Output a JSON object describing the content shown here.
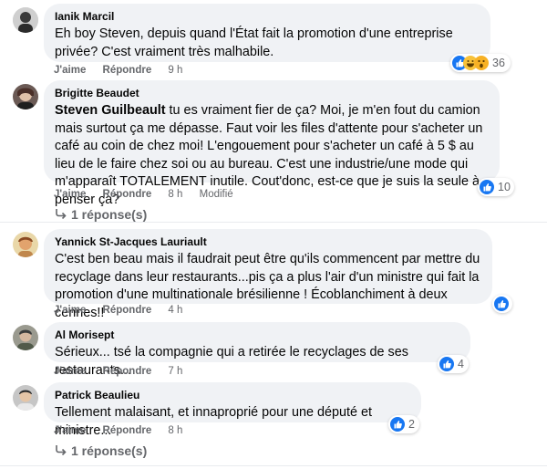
{
  "comments": [
    {
      "author": "Ianik Marcil",
      "text": "Eh boy Steven, depuis quand l'État fait la promotion d'une entreprise privée? C'est vraiment très malhabile.",
      "like_label": "J'aime",
      "reply_label": "Répondre",
      "time": "9 h",
      "reaction_count": "36",
      "reactions": [
        "like-icon",
        "haha-icon",
        "wow-icon"
      ]
    },
    {
      "author": "Brigitte Beaudet",
      "mention": "Steven Guilbeault",
      "text": " tu es vraiment fier de ça? Moi, je m'en fout du camion mais surtout ça me dépasse. Faut voir les files d'attente pour s'acheter un café au coin de chez moi! L'engouement pour s'acheter un café à 5 $ au lieu de le faire chez soi ou au bureau. C'est une industrie/une mode qui m'apparaît TOTALEMENT inutile. Cout'donc, est-ce que je suis la seule à penser ça?",
      "like_label": "J'aime",
      "reply_label": "Répondre",
      "time": "8 h",
      "edited": "Modifié",
      "reaction_count": "10",
      "replies_label": "1 réponse(s)"
    },
    {
      "author": "Yannick St-Jacques Lauriault",
      "text": "C'est ben beau mais il faudrait peut être qu'ils commencent par mettre du recyclage dans leur restaurants...pis ça a plus l'air d'un ministre qui fait la promotion d'une multinationale brésilienne ! Écoblanchiment à deux cennes!!",
      "like_label": "J'aime",
      "reply_label": "Répondre",
      "time": "4 h",
      "reaction_count": ""
    },
    {
      "author": "Al Morisept",
      "text": "Sérieux... tsé la compagnie qui a retirée le recyclages de ses restaurants...",
      "like_label": "J'aime",
      "reply_label": "Répondre",
      "time": "7 h",
      "reaction_count": "4"
    },
    {
      "author": "Patrick Beaulieu",
      "text": "Tellement malaisant, et innaproprié pour une député et ministre...",
      "like_label": "J'aime",
      "reply_label": "Répondre",
      "time": "8 h",
      "reaction_count": "2",
      "replies_label": "1 réponse(s)"
    }
  ],
  "colors": {
    "bubble": "#f0f2f5",
    "meta": "#65676b",
    "like": "#1877f2"
  }
}
